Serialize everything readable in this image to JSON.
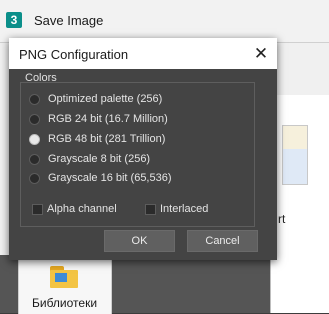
{
  "parent_window": {
    "icon_glyph": "3",
    "title": "Save Image",
    "background_text": "rt",
    "library_label": "Библиотеки"
  },
  "dialog": {
    "title": "PNG Configuration",
    "close_glyph": "✕",
    "colors_group": {
      "label": "Colors",
      "options": [
        {
          "label": "Optimized palette  (256)",
          "checked": false
        },
        {
          "label": "RGB 24 bit  (16.7 Million)",
          "checked": false
        },
        {
          "label": "RGB 48 bit  (281 Trillion)",
          "checked": true
        },
        {
          "label": "Grayscale 8 bit  (256)",
          "checked": false
        },
        {
          "label": "Grayscale 16 bit  (65,536)",
          "checked": false
        }
      ]
    },
    "alpha_channel": {
      "label": "Alpha channel",
      "checked": false
    },
    "interlaced": {
      "label": "Interlaced",
      "checked": false
    },
    "ok_label": "OK",
    "cancel_label": "Cancel"
  },
  "icons": {
    "app": "3dsmax-app-icon",
    "close": "close-icon",
    "folder": "library-folder-icon"
  },
  "colors": {
    "dialog_bg": "#444444",
    "button_bg": "#606060",
    "text": "#e4e4e4"
  }
}
